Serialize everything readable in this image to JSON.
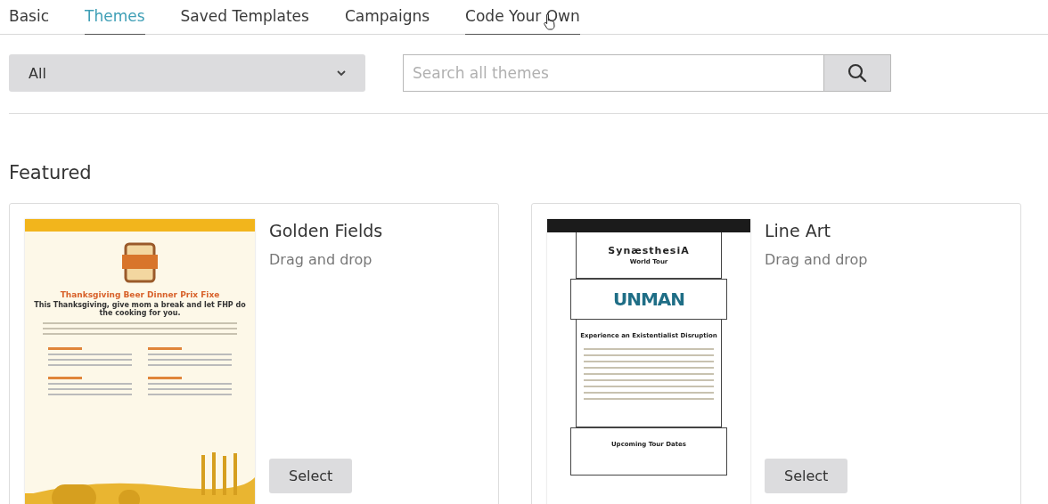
{
  "tabs": [
    {
      "label": "Basic",
      "selected": false,
      "hovered": false
    },
    {
      "label": "Themes",
      "selected": true,
      "hovered": false
    },
    {
      "label": "Saved Templates",
      "selected": false,
      "hovered": false
    },
    {
      "label": "Campaigns",
      "selected": false,
      "hovered": false
    },
    {
      "label": "Code Your Own",
      "selected": false,
      "hovered": true
    }
  ],
  "filter": {
    "value": "All"
  },
  "search": {
    "placeholder": "Search all themes"
  },
  "section_title": "Featured",
  "themes": [
    {
      "kind": "harvest",
      "name": "Golden Fields",
      "type": "Drag and drop",
      "button": "Select",
      "preview": {
        "title": "Thanksgiving Beer Dinner Prix Fixe",
        "subtitle": "This Thanksgiving, give mom a break and let FHP do the cooking for you."
      }
    },
    {
      "kind": "boxed",
      "name": "Line Art",
      "type": "Drag and drop",
      "button": "Select",
      "preview": {
        "title": "SynæsthesiA",
        "subtitle": "World Tour",
        "logo": "UNMAN",
        "heading": "Experience an Existentialist Disruption",
        "footer_heading": "Upcoming Tour Dates"
      }
    }
  ]
}
